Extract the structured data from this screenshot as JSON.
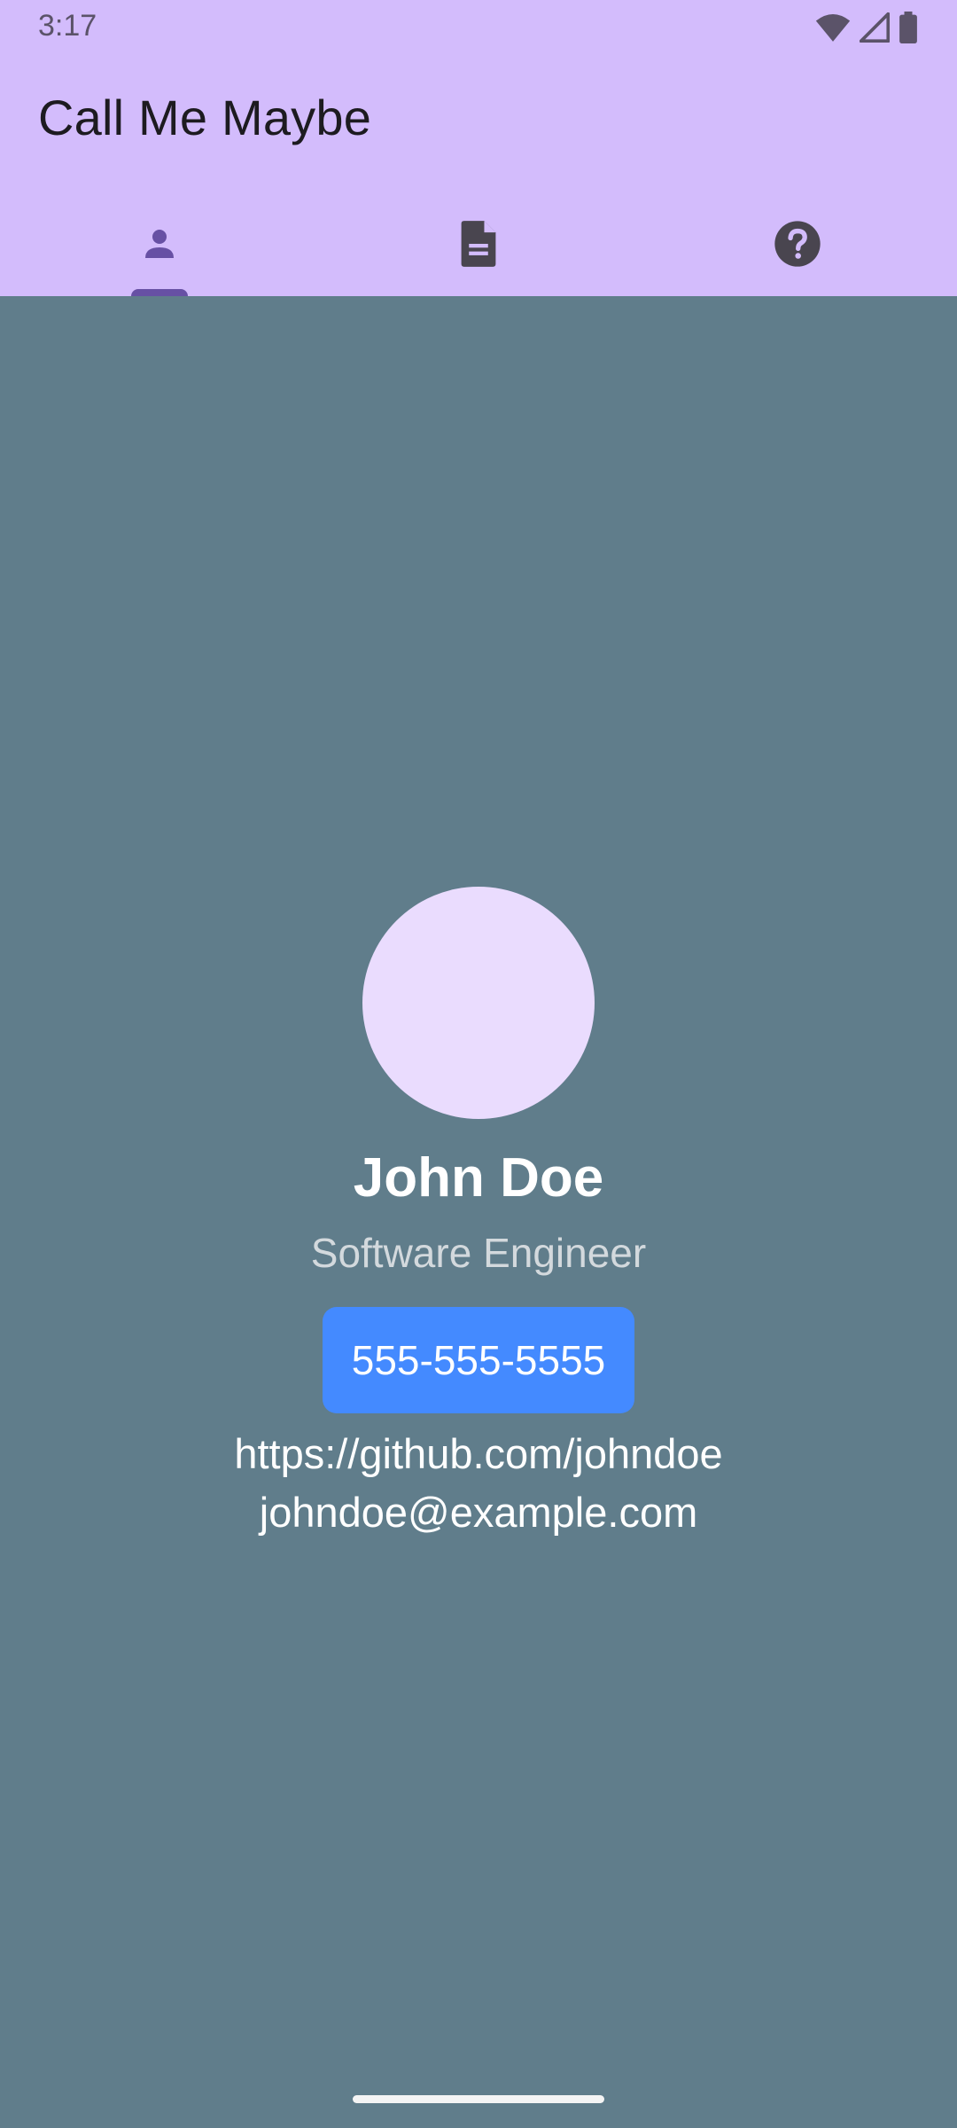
{
  "status_bar": {
    "time": "3:17",
    "icons": [
      "wifi-icon",
      "cellular-signal-icon",
      "battery-icon"
    ]
  },
  "app_bar": {
    "title": "Call Me Maybe"
  },
  "tabs": [
    {
      "icon": "person-icon",
      "selected": true
    },
    {
      "icon": "document-icon",
      "selected": false
    },
    {
      "icon": "help-icon",
      "selected": false
    }
  ],
  "profile": {
    "name": "John Doe",
    "role": "Software Engineer",
    "phone": "555-555-5555",
    "github": "https://github.com/johndoe",
    "email": "johndoe@example.com"
  },
  "colors": {
    "app_bar_bg": "#d3bcfc",
    "screen_bg": "#607d8b",
    "avatar_bg": "#eadcfe",
    "phone_button_bg": "#448aff",
    "tab_indicator": "#6750a4",
    "selected_tab_icon": "#6750a4",
    "unselected_tab_icon": "#49454f"
  }
}
